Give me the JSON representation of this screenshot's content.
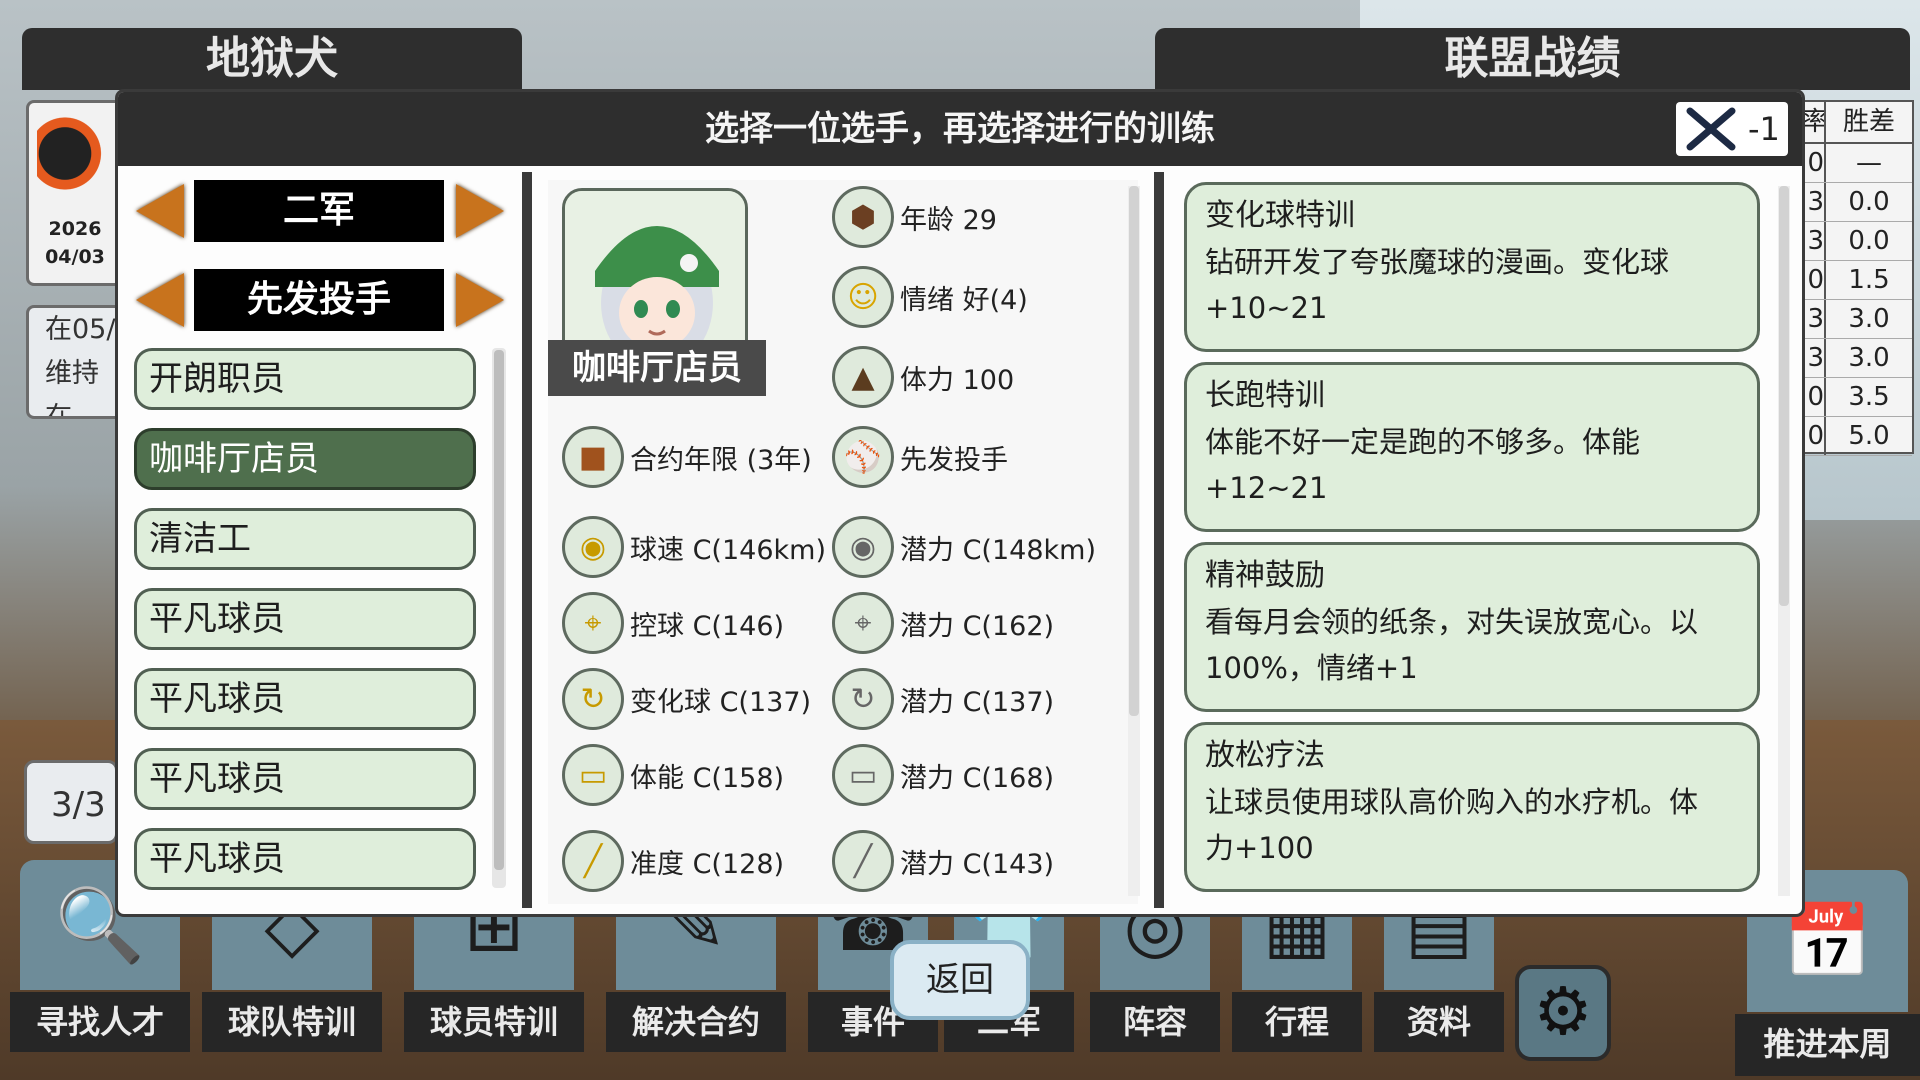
{
  "background": {
    "team_panel_title": "地狱犬",
    "standings_title": "联盟战绩",
    "team_date_year": "2026",
    "team_date_day": "04/03",
    "notice_line1": "在05/",
    "notice_line2": "维持在",
    "count": "3/3",
    "standings": {
      "header_c1": "率",
      "header_c2": "胜差",
      "rows": [
        {
          "c1": "0",
          "c2": "—"
        },
        {
          "c1": "3",
          "c2": "0.0"
        },
        {
          "c1": "3",
          "c2": "0.0"
        },
        {
          "c1": "0",
          "c2": "1.5"
        },
        {
          "c1": "3",
          "c2": "3.0"
        },
        {
          "c1": "3",
          "c2": "3.0"
        },
        {
          "c1": "0",
          "c2": "3.5"
        },
        {
          "c1": "0",
          "c2": "5.0"
        }
      ]
    }
  },
  "toolbar": {
    "items": [
      {
        "label": "寻找人才",
        "icon": "magnifier-baseball-icon"
      },
      {
        "label": "球队特训",
        "icon": "field-diagram-icon"
      },
      {
        "label": "球员特训",
        "icon": "dumbbell-icon"
      },
      {
        "label": "解决合约",
        "icon": "contract-icon"
      },
      {
        "label": "事件",
        "icon": "phone-icon"
      },
      {
        "label": "二军",
        "icon": "jersey-icon"
      },
      {
        "label": "阵容",
        "icon": "stadium-icon"
      },
      {
        "label": "行程",
        "icon": "player-card-icon"
      },
      {
        "label": "资料",
        "icon": "book-icon"
      }
    ],
    "advance_label": "推进本周"
  },
  "modal": {
    "title": "选择一位选手，再选择进行的训练",
    "bat_count": "-1",
    "team_selector": "二军",
    "position_selector": "先发投手",
    "players": [
      "开朗职员",
      "咖啡厅店员",
      "清洁工",
      "平凡球员",
      "平凡球员",
      "平凡球员",
      "平凡球员"
    ],
    "selected_index": 1,
    "player": {
      "name": "咖啡厅店员",
      "age": "年龄 29",
      "mood": "情绪 好(4)",
      "stamina": "体力 100",
      "contract": "合约年限 (3年)",
      "role": "先发投手",
      "velocity": "球速 C(146km)",
      "velocity_pot": "潜力 C(148km)",
      "control": "控球 C(146)",
      "control_pot": "潜力 C(162)",
      "breaking": "变化球 C(137)",
      "breaking_pot": "潜力 C(137)",
      "fitness": "体能 C(158)",
      "fitness_pot": "潜力 C(168)",
      "accuracy": "准度 C(128)",
      "accuracy_pot": "潜力 C(143)"
    },
    "trainings": [
      {
        "name": "变化球特训",
        "desc1": "钻研开发了夸张魔球的漫画。变化球",
        "desc2": "+10~21"
      },
      {
        "name": "长跑特训",
        "desc1": "体能不好一定是跑的不够多。体能",
        "desc2": "+12~21"
      },
      {
        "name": "精神鼓励",
        "desc1": "看每月会领的纸条，对失误放宽心。以",
        "desc2": "100%，情绪+1"
      },
      {
        "name": "放松疗法",
        "desc1": "让球员使用球队高价购入的水疗机。体",
        "desc2": "力+100"
      }
    ],
    "back_label": "返回"
  }
}
